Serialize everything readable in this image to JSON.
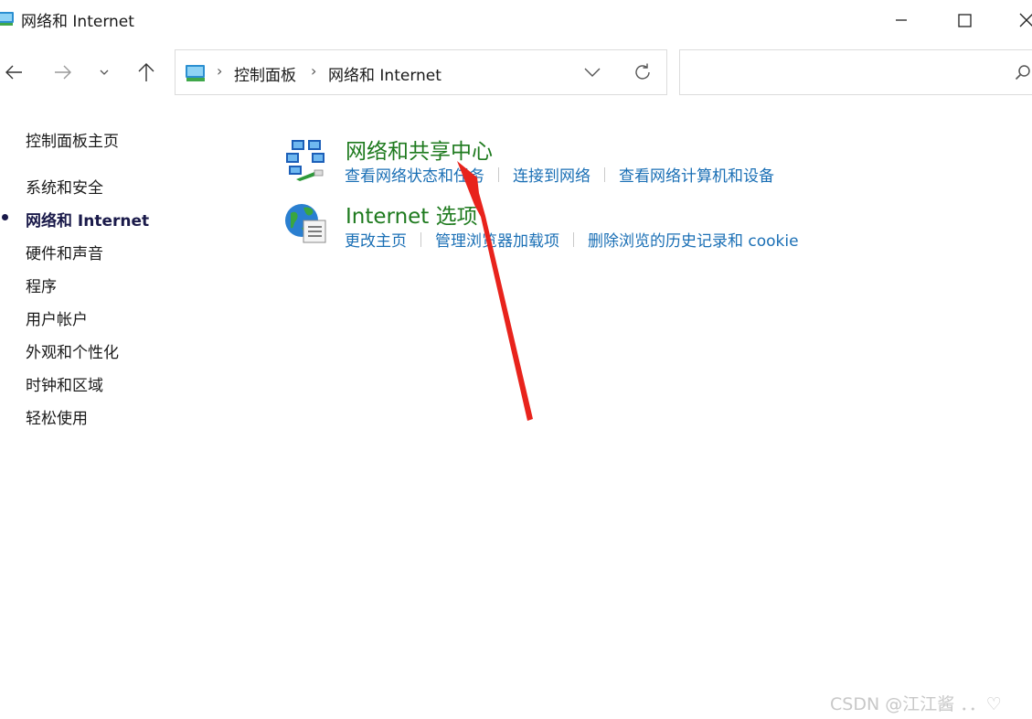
{
  "window": {
    "title": "网络和 Internet",
    "icons": [
      "control-panel-icon",
      "minimize-icon",
      "maximize-icon",
      "close-icon"
    ]
  },
  "nav": {
    "back_icon": "arrow-left-icon",
    "forward_icon": "arrow-right-icon",
    "recent_icon": "chevron-down-icon",
    "up_icon": "arrow-up-icon"
  },
  "address": {
    "crumbs": [
      "控制面板",
      "网络和 Internet"
    ],
    "separator": "›",
    "icons": [
      "control-panel-icon",
      "chevron-down-icon",
      "refresh-icon"
    ]
  },
  "search": {
    "placeholder": "",
    "icon": "search-icon"
  },
  "sidebar": {
    "items": [
      {
        "label": "控制面板主页",
        "active": false
      },
      {
        "label": "系统和安全",
        "active": false
      },
      {
        "label": "网络和 Internet",
        "active": true
      },
      {
        "label": "硬件和声音",
        "active": false
      },
      {
        "label": "程序",
        "active": false
      },
      {
        "label": "用户帐户",
        "active": false
      },
      {
        "label": "外观和个性化",
        "active": false
      },
      {
        "label": "时钟和区域",
        "active": false
      },
      {
        "label": "轻松使用",
        "active": false
      }
    ]
  },
  "categories": [
    {
      "title": "网络和共享中心",
      "icon": "network-sharing-icon",
      "links": [
        "查看网络状态和任务",
        "连接到网络",
        "查看网络计算机和设备"
      ]
    },
    {
      "title": "Internet 选项",
      "icon": "internet-options-icon",
      "links": [
        "更改主页",
        "管理浏览器加载项",
        "删除浏览的历史记录和 cookie"
      ]
    }
  ],
  "watermark": {
    "text": "CSDN @江江酱 ．．♡"
  },
  "colors": {
    "category_title": "#1e7a1e",
    "link": "#1a6fb5",
    "arrow": "#e8231c"
  }
}
